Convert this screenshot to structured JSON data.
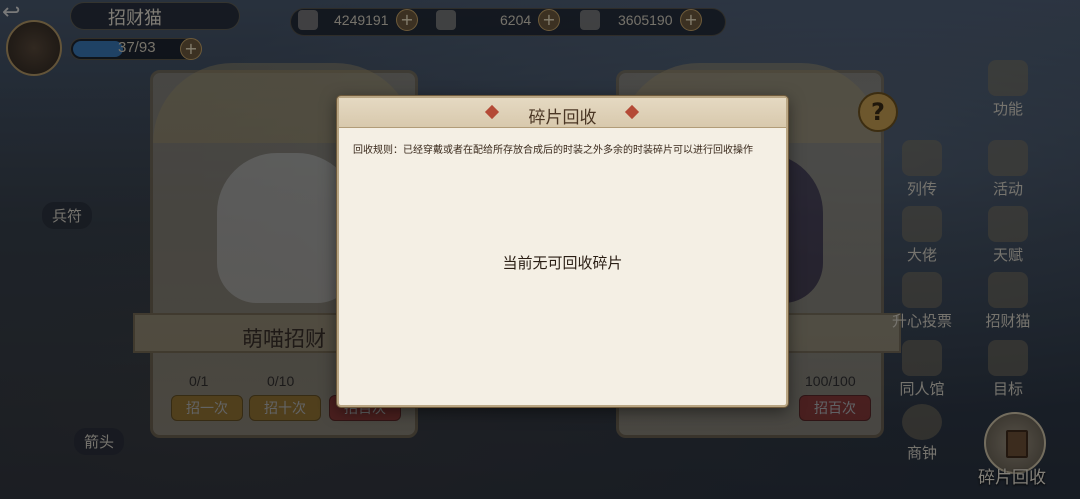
{
  "hud": {
    "back_icon": "back-arrow-icon",
    "title": "招财猫",
    "energy_text": "37/93",
    "energy_fraction": 0.4,
    "currencies": [
      "4249191",
      "6204",
      "3605190"
    ]
  },
  "panels": {
    "left": {
      "title": "萌喵招财",
      "counts": [
        "0/1",
        "0/10"
      ],
      "buttons": [
        "招一次",
        "招十次",
        "招百次"
      ]
    },
    "right": {
      "counts": [
        "100/100"
      ],
      "buttons": [
        "招百次"
      ]
    }
  },
  "left_labels": [
    "兵符",
    "箭头"
  ],
  "side_menu": [
    "功能",
    "列传",
    "活动",
    "大佬",
    "天赋",
    "升心投票",
    "招财猫",
    "同人馆",
    "目标",
    "商钟"
  ],
  "recycle_button_label": "碎片回收",
  "modal": {
    "title": "碎片回收",
    "rule": "回收规则：已经穿戴或者在配给所存放合成后的时装之外多余的时装碎片可以进行回收操作",
    "empty_message": "当前无可回收碎片"
  }
}
